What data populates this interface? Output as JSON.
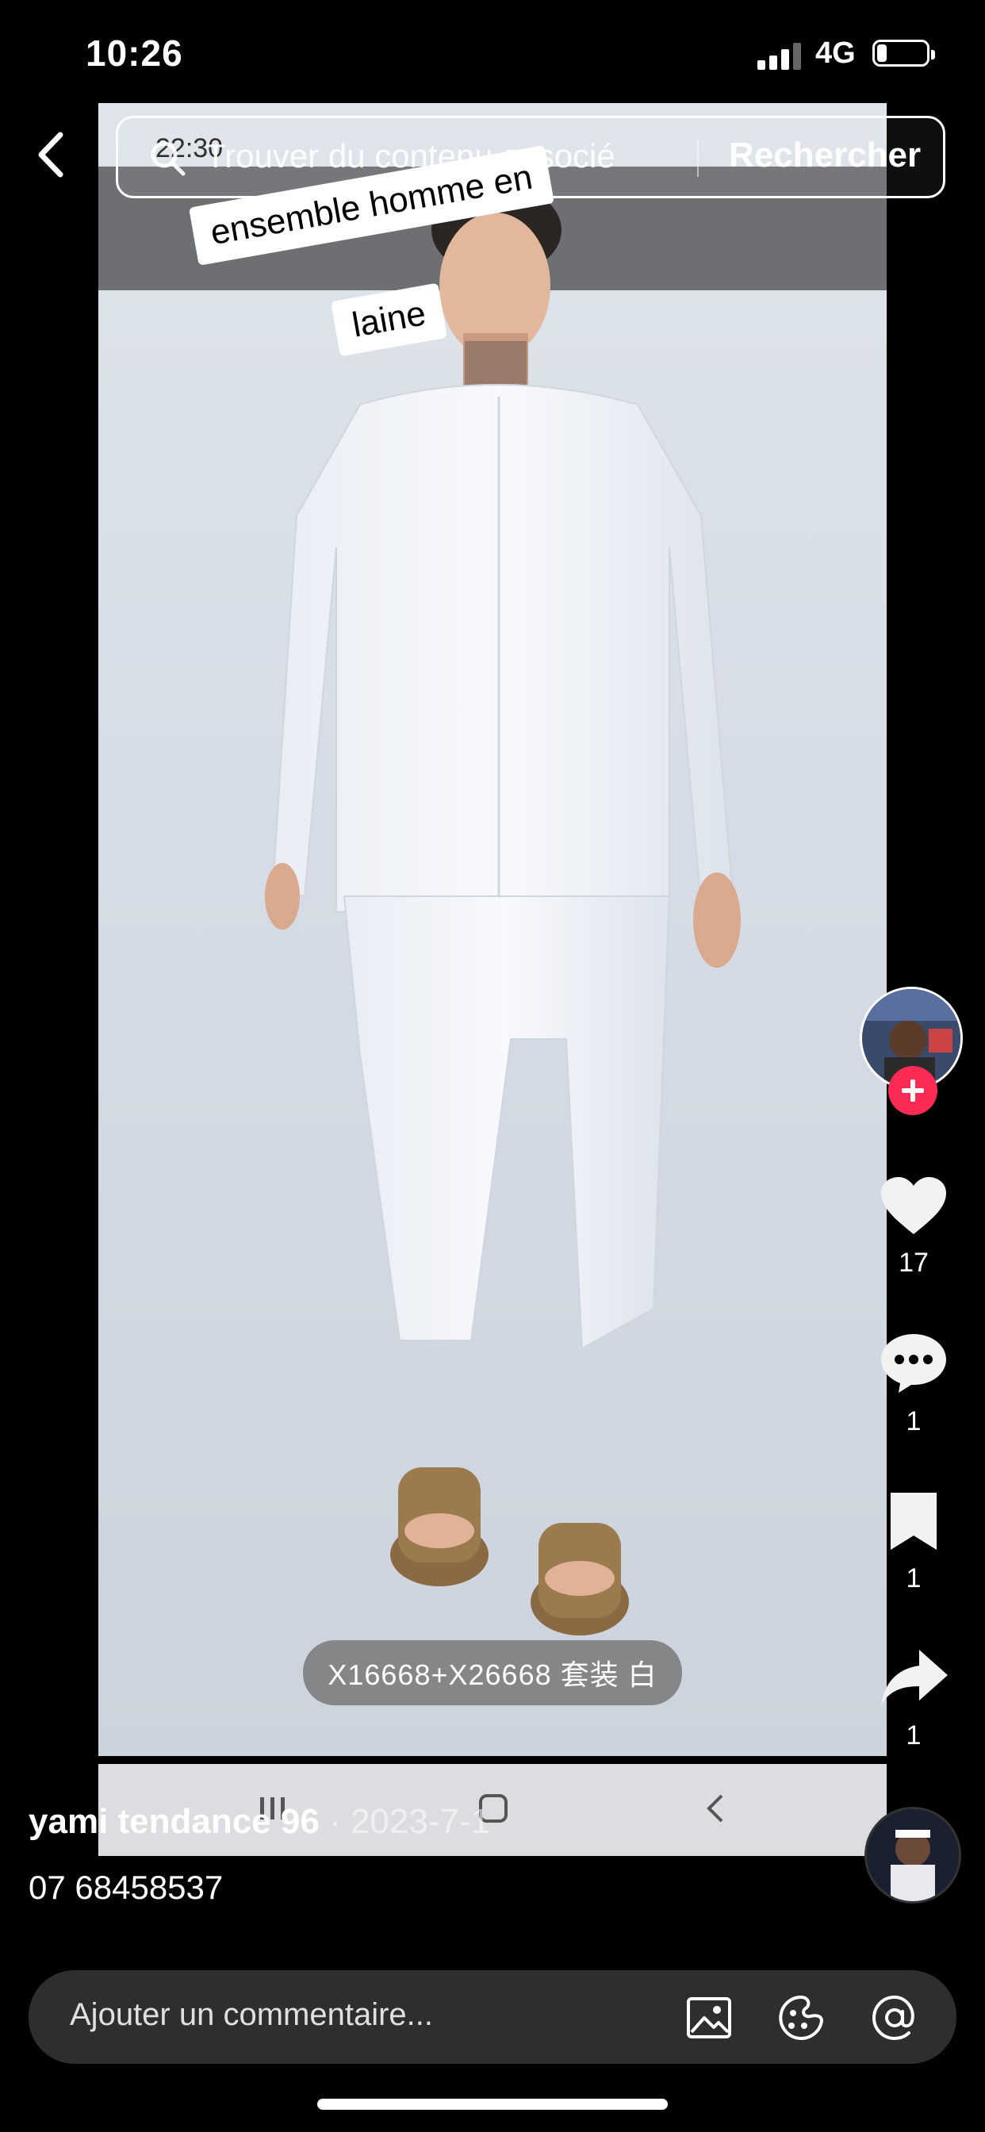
{
  "status_bar": {
    "time": "10:26",
    "network": "4G"
  },
  "video": {
    "inner_time": "22:30",
    "product_label": "X16668+X26668 套装 白"
  },
  "search": {
    "placeholder": "Trouver du contenu associé",
    "button_label": "Rechercher"
  },
  "sticker": {
    "line1": "ensemble homme en",
    "line2": "laine"
  },
  "actions": {
    "likes": "17",
    "comments": "1",
    "saves": "1",
    "shares": "1"
  },
  "author": {
    "name": "yami tendance 96",
    "date": " · 2023-7-1"
  },
  "caption": "07 68458537",
  "comment_bar": {
    "placeholder": "Ajouter un commentaire..."
  },
  "colors": {
    "accent": "#fe2c55",
    "background": "#000000"
  }
}
